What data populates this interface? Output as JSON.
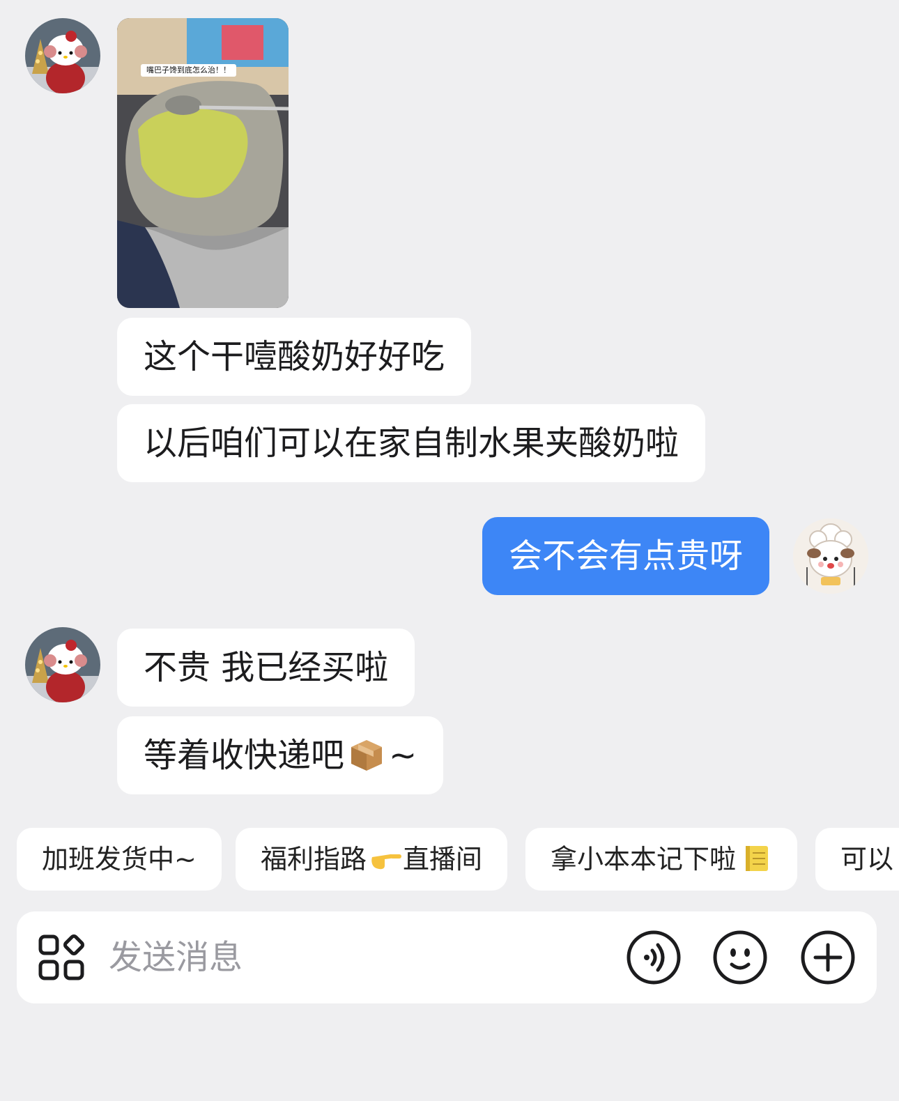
{
  "image_message": {
    "caption": "嘴巴子馋到底怎么治！！"
  },
  "messages": [
    {
      "side": "left",
      "text": "这个干噎酸奶好好吃"
    },
    {
      "side": "left",
      "text": "以后咱们可以在家自制水果夹酸奶啦"
    },
    {
      "side": "right",
      "text": "会不会有点贵呀"
    },
    {
      "side": "left",
      "text": "不贵 我已经买啦"
    },
    {
      "side": "left",
      "text": "等着收快递吧",
      "suffix": "~",
      "emoji": "package-emoji"
    }
  ],
  "quick_replies": [
    {
      "label": "加班发货中~"
    },
    {
      "label": "福利指路",
      "emoji": "pointing-hand-emoji",
      "label_after": "直播间"
    },
    {
      "label": "拿小本本记下啦",
      "emoji": "notebook-emoji"
    },
    {
      "label": "可以"
    }
  ],
  "input": {
    "placeholder": "发送消息",
    "icons": [
      "apps-icon",
      "voice-icon",
      "emoji-icon",
      "plus-icon"
    ]
  },
  "colors": {
    "background": "#efeff1",
    "bubble_left": "#ffffff",
    "bubble_right": "#3d86f6"
  }
}
